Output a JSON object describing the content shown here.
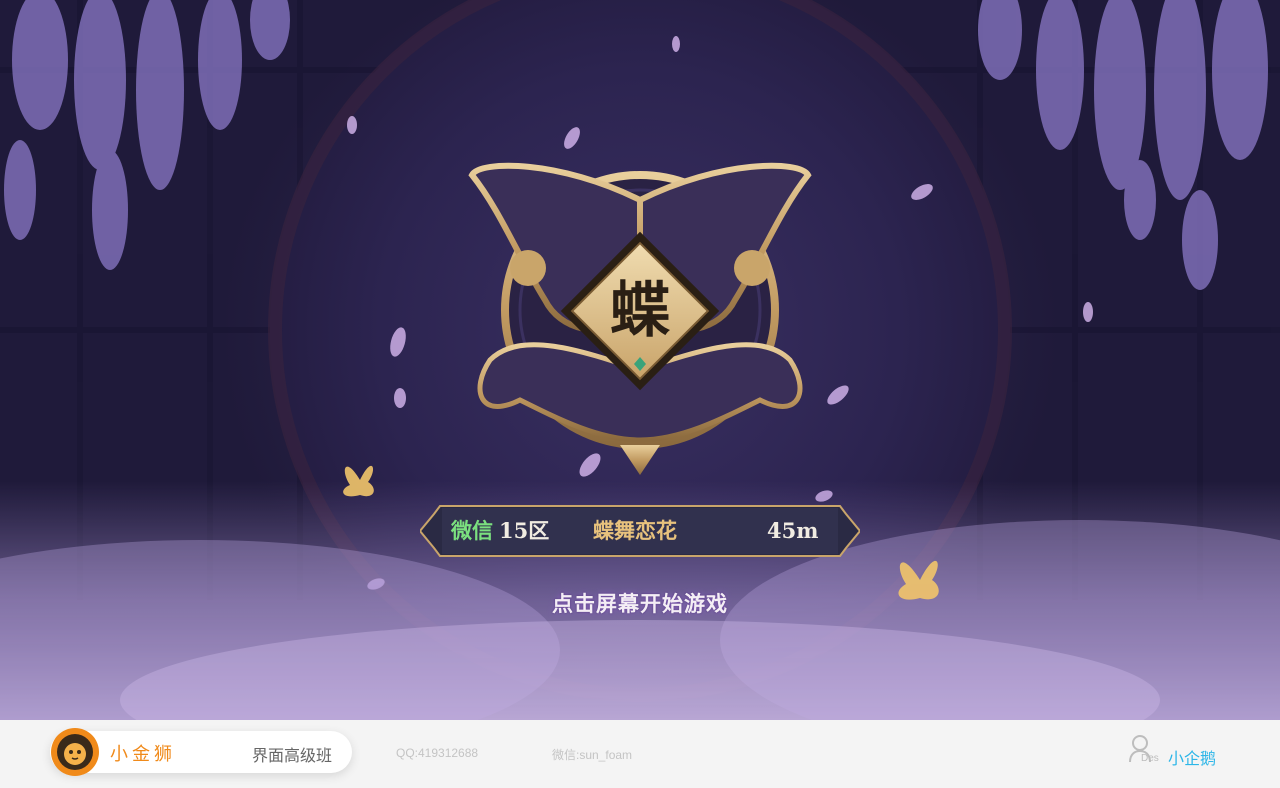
{
  "game": {
    "emblem_char": "蝶",
    "server": {
      "platform": "微信",
      "zone": "15区",
      "name": "蝶舞恋花",
      "ping": "45m"
    },
    "start_prompt": "点击屏幕开始游戏"
  },
  "footer": {
    "brand": "小金狮",
    "course": "界面高级班",
    "qq": "QQ:419312688",
    "wechat": "微信:sun_foam",
    "designer_tag": "Des",
    "designer": "小企鹅"
  },
  "colors": {
    "background": "#2a2248",
    "emblem_gold": "#c9a56a",
    "platform_green": "#7be07f",
    "server_gold": "#e8c27d",
    "brand_orange": "#f08a1a",
    "designer_blue": "#2cb6e8"
  },
  "icons": {
    "emblem": "butterfly-emblem-icon",
    "brand_logo": "lion-logo-icon",
    "user": "user-icon",
    "butterflies": "butterfly-icon"
  }
}
